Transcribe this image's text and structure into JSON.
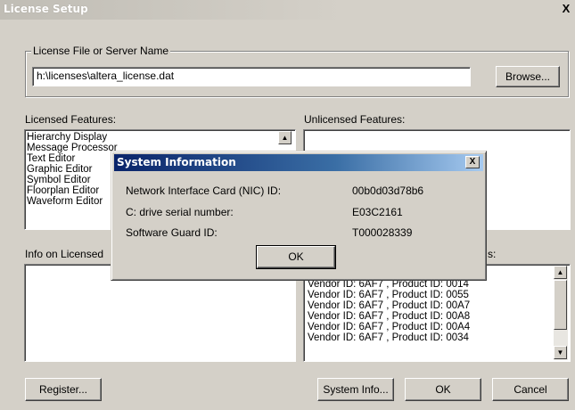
{
  "window": {
    "title": "License Setup",
    "close_glyph": "X"
  },
  "license_group": {
    "legend": "License File or Server Name",
    "file_value": "h:\\licenses\\altera_license.dat",
    "browse_label": "Browse..."
  },
  "licensed": {
    "label": "Licensed Features:",
    "items": [
      "Hierarchy Display",
      "Message Processor",
      "Text Editor",
      "Graphic Editor",
      "Symbol Editor",
      "Floorplan Editor",
      "Waveform Editor"
    ]
  },
  "unlicensed": {
    "label": "Unlicensed Features:"
  },
  "info": {
    "label": "Info on Licensed",
    "label_right_tail": "s:"
  },
  "vendor": {
    "items": [
      "Vendor ID: 6AF7 , Product ID: 0014",
      "Vendor ID: 6AF7 , Product ID: 0055",
      "Vendor ID: 6AF7 , Product ID: 00A7",
      "Vendor ID: 6AF7 , Product ID: 00A8",
      "Vendor ID: 6AF7 , Product ID: 00A4",
      "Vendor ID: 6AF7 , Product ID: 0034"
    ]
  },
  "buttons": {
    "register": "Register...",
    "system_info": "System Info...",
    "ok": "OK",
    "cancel": "Cancel"
  },
  "dialog": {
    "title": "System Information",
    "close_glyph": "X",
    "rows": [
      {
        "label": "Network Interface Card (NIC) ID:",
        "value": "00b0d03d78b6"
      },
      {
        "label": "C: drive serial number:",
        "value": "E03C2161"
      },
      {
        "label": "Software Guard ID:",
        "value": "T000028339"
      }
    ],
    "ok_label": "OK"
  },
  "icons": {
    "scroll_up": "scroll-up-arrow-icon",
    "scroll_down": "scroll-down-arrow-icon"
  }
}
